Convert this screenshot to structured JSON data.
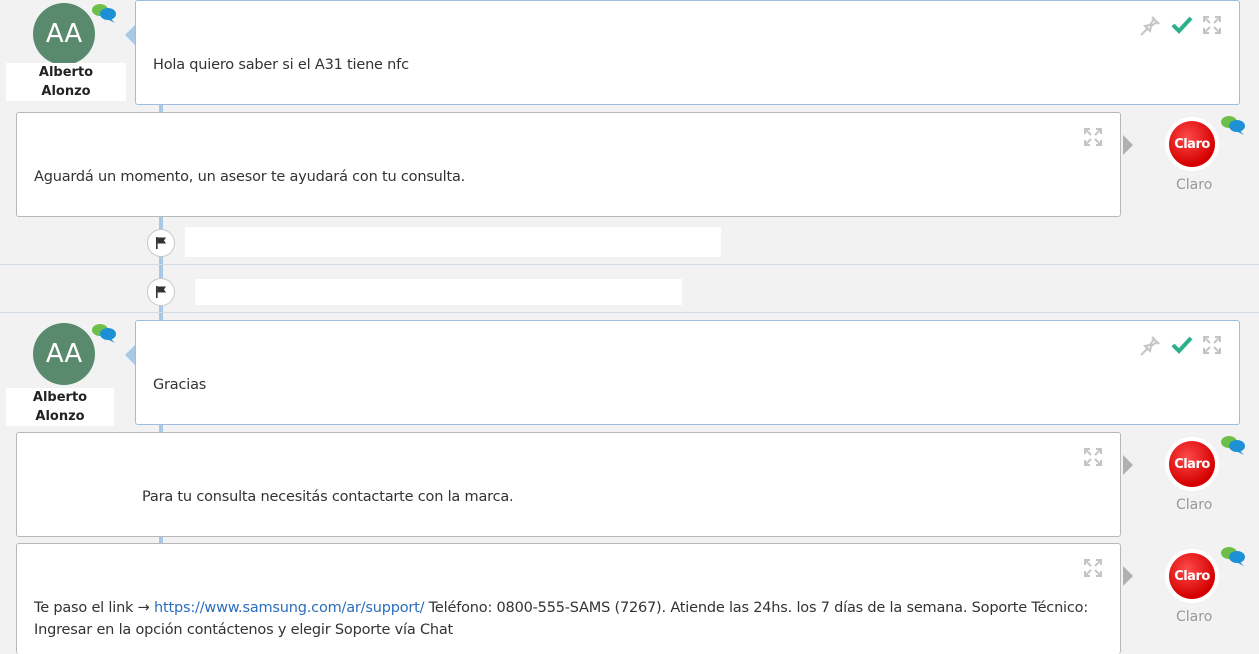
{
  "messages": [
    {
      "author_initials": "AA",
      "author_name": "Alberto\nAlonzo",
      "text": "Hola quiero saber si el A31 tiene nfc"
    },
    {
      "author_name": "Claro",
      "logo_text": "Claro",
      "text": "Aguardá un momento, un asesor te ayudará con tu consulta."
    },
    {
      "author_initials": "AA",
      "author_name": "Alberto\nAlonzo",
      "text": "Gracias"
    },
    {
      "author_name": "Claro",
      "logo_text": "Claro",
      "text": "Para tu consulta necesitás contactarte con la marca."
    },
    {
      "author_name": "Claro",
      "logo_text": "Claro",
      "text_before_link": "Te paso el link → ",
      "link": "https://www.samsung.com/ar/support/",
      "text_after_link": " Teléfono: 0800-555-SAMS (7267). Atiende las 24hs. los 7 días de la semana. Soporte Técnico:",
      "text_line2": "Ingresar en la opción contáctenos y elegir Soporte vía Chat"
    }
  ],
  "icons": {
    "pin": "pin-icon",
    "check": "check-icon",
    "expand": "expand-icon",
    "flag": "flag-icon",
    "chat": "chat-bubbles-icon"
  },
  "colors": {
    "client_border": "#9fbcdb",
    "agent_border": "#b8b8b8",
    "avatar_bg": "#5a8a6e",
    "check_green": "#2bb08a",
    "claro_red": "#d40000",
    "link_blue": "#2a6ebd"
  }
}
